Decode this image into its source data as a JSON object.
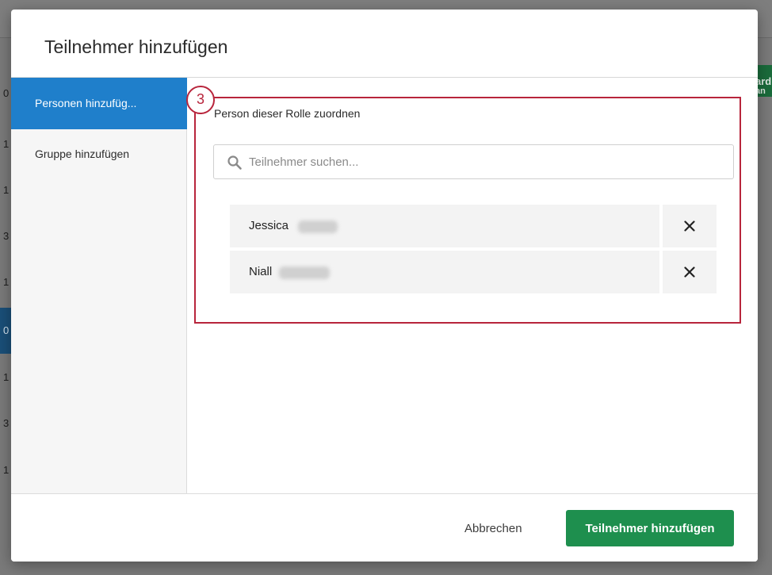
{
  "modal": {
    "title": "Teilnehmer hinzufügen"
  },
  "sidebar": {
    "items": [
      {
        "label": "Personen hinzufüg...",
        "active": true
      },
      {
        "label": "Gruppe hinzufügen",
        "active": false
      }
    ]
  },
  "main": {
    "step_number": "3",
    "section_label": "Person dieser Rolle zuordnen",
    "search": {
      "placeholder": "Teilnehmer suchen...",
      "value": ""
    },
    "participants": [
      {
        "first_name": "Jessica"
      },
      {
        "first_name": "Niall"
      }
    ]
  },
  "footer": {
    "cancel_label": "Abbrechen",
    "submit_label": "Teilnehmer hinzufügen"
  },
  "background": {
    "row_numbers": [
      "0",
      "1",
      "1",
      "3",
      "1",
      "0",
      "1",
      "3",
      "1"
    ],
    "button_fragment": [
      "ard",
      "an"
    ]
  },
  "colors": {
    "accent_blue": "#1f7fcb",
    "primary_green": "#1e8f4e",
    "highlight_red": "#b8253c"
  },
  "icons": {
    "search": "search-icon",
    "remove": "close-icon"
  }
}
